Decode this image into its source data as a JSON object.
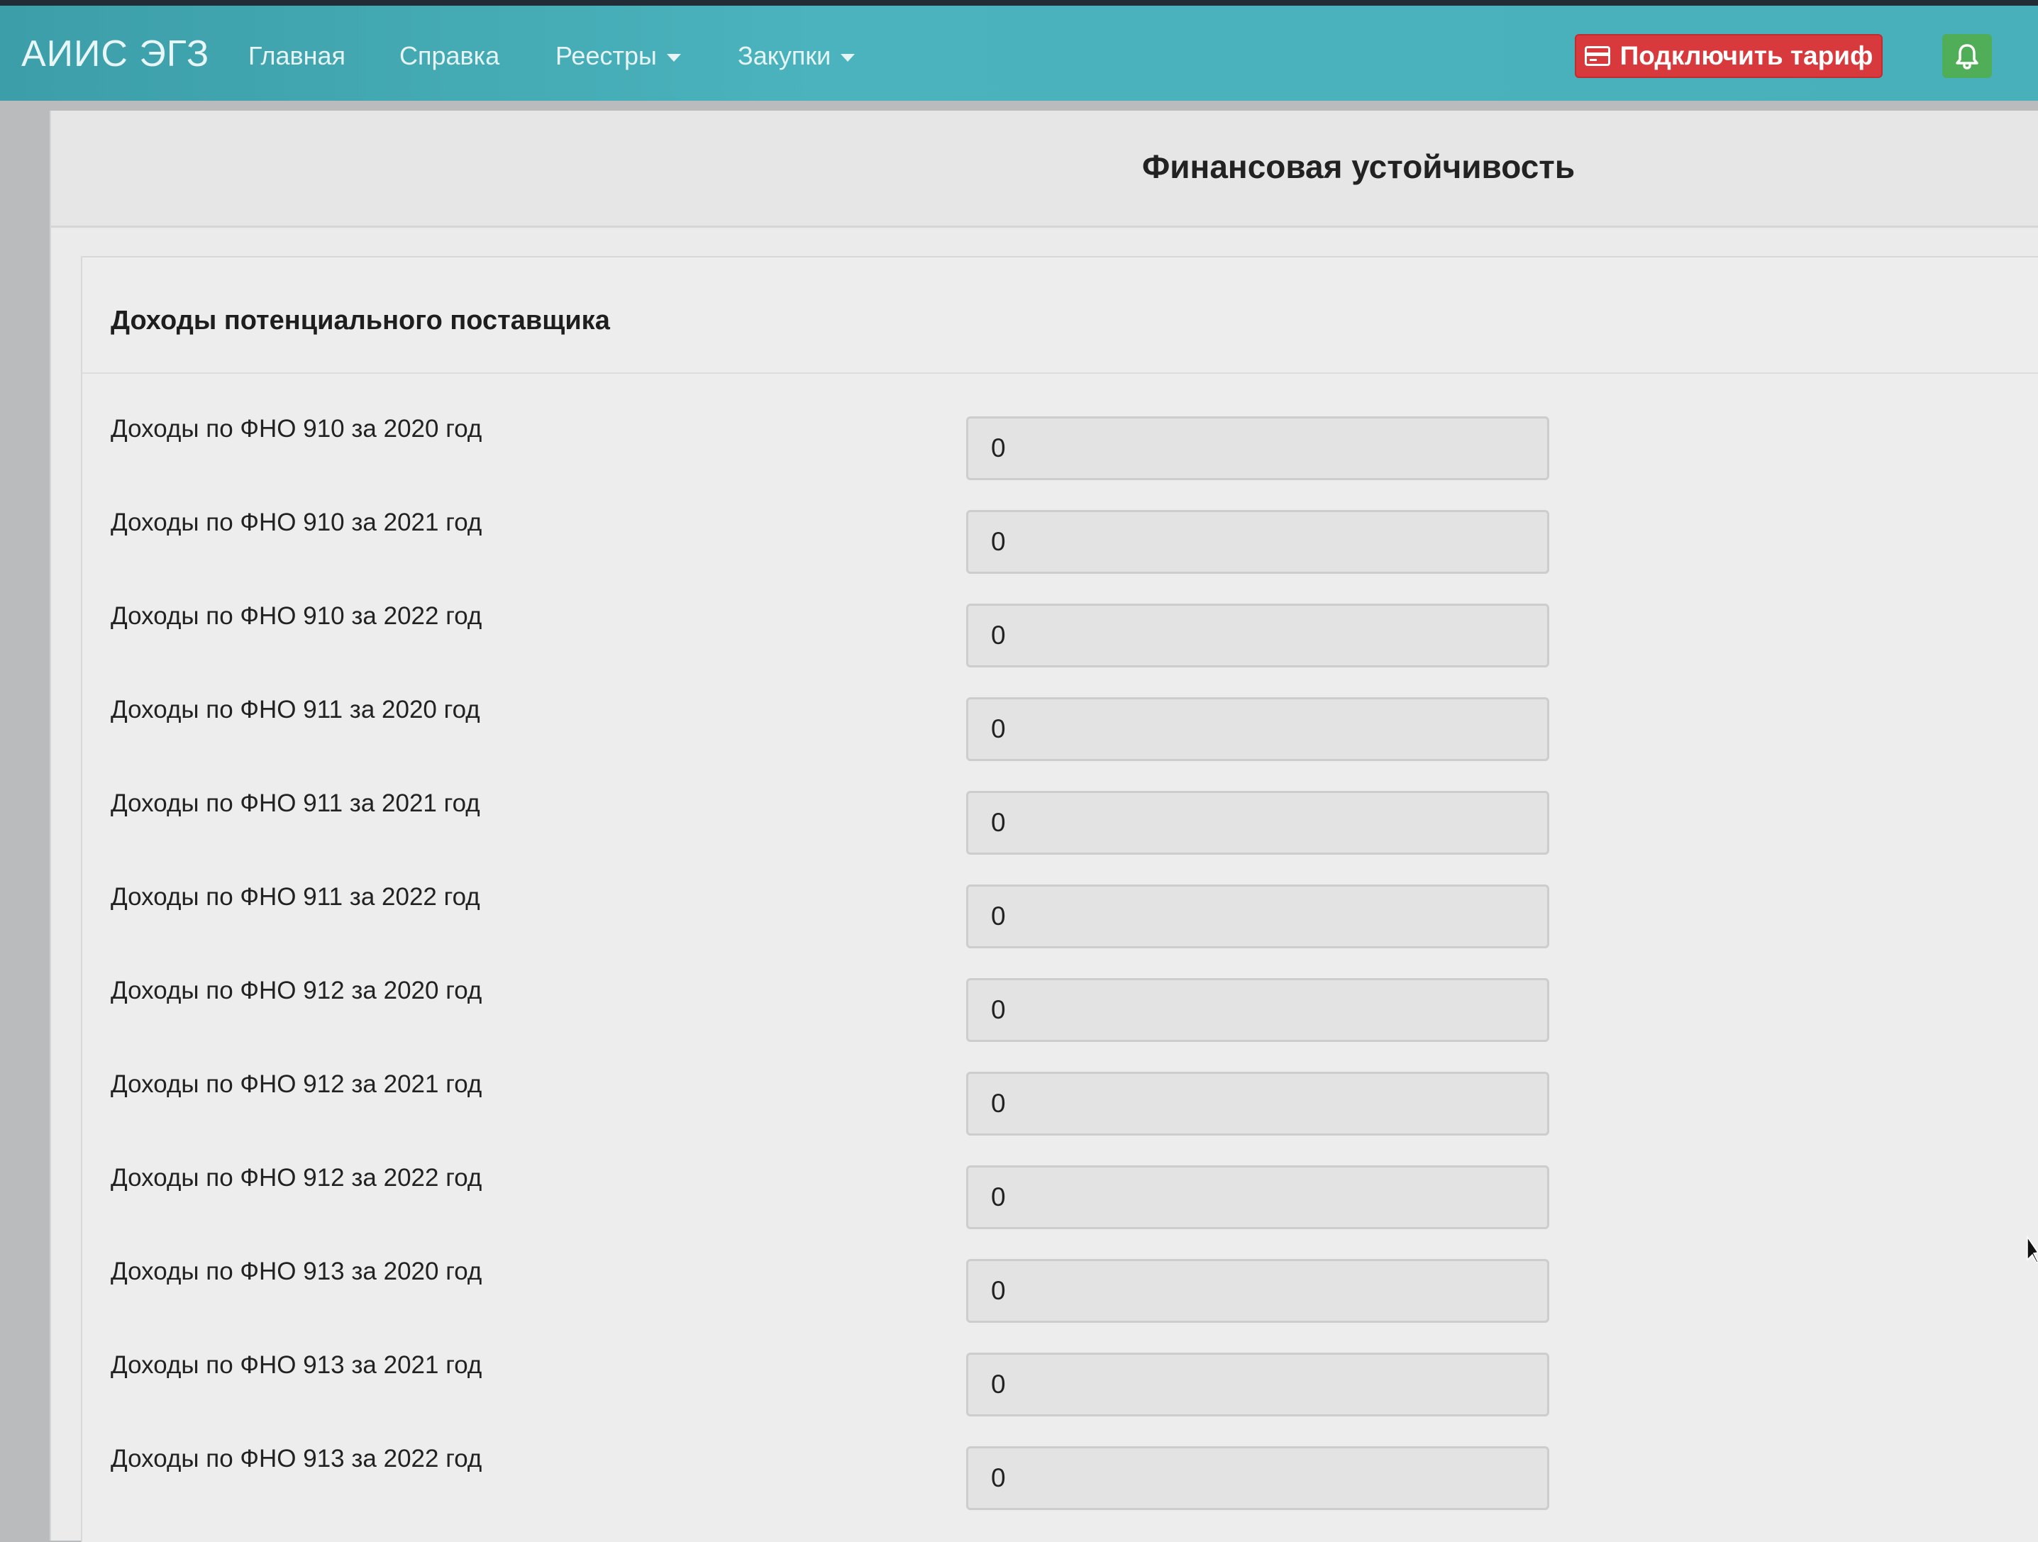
{
  "app": {
    "brand": "АИИС ЭГЗ"
  },
  "nav": {
    "items": [
      {
        "label": "Главная",
        "dropdown": false
      },
      {
        "label": "Справка",
        "dropdown": false
      },
      {
        "label": "Реестры",
        "dropdown": true
      },
      {
        "label": "Закупки",
        "dropdown": true
      }
    ],
    "tariff_button": "Подключить тариф"
  },
  "page": {
    "title": "Финансовая устойчивость"
  },
  "section": {
    "title": "Доходы потенциального поставщика",
    "rows": [
      {
        "label": "Доходы по ФНО 910 за 2020 год",
        "value": "0"
      },
      {
        "label": "Доходы по ФНО 910 за 2021 год",
        "value": "0"
      },
      {
        "label": "Доходы по ФНО 910 за 2022 год",
        "value": "0"
      },
      {
        "label": "Доходы по ФНО 911 за 2020 год",
        "value": "0"
      },
      {
        "label": "Доходы по ФНО 911 за 2021 год",
        "value": "0"
      },
      {
        "label": "Доходы по ФНО 911 за 2022 год",
        "value": "0"
      },
      {
        "label": "Доходы по ФНО 912 за 2020 год",
        "value": "0"
      },
      {
        "label": "Доходы по ФНО 912 за 2021 год",
        "value": "0"
      },
      {
        "label": "Доходы по ФНО 912 за 2022 год",
        "value": "0"
      },
      {
        "label": "Доходы по ФНО 913 за 2020 год",
        "value": "0"
      },
      {
        "label": "Доходы по ФНО 913 за 2021 год",
        "value": "0"
      },
      {
        "label": "Доходы по ФНО 913 за 2022 год",
        "value": "0"
      }
    ]
  },
  "colors": {
    "navbar": "#48b0ba",
    "tariff_button": "#d8393c",
    "bell_button": "#4fae57"
  },
  "icons": {
    "tariff": "credit-card-icon",
    "notifications": "bell-icon",
    "dropdown": "caret-down-icon"
  }
}
